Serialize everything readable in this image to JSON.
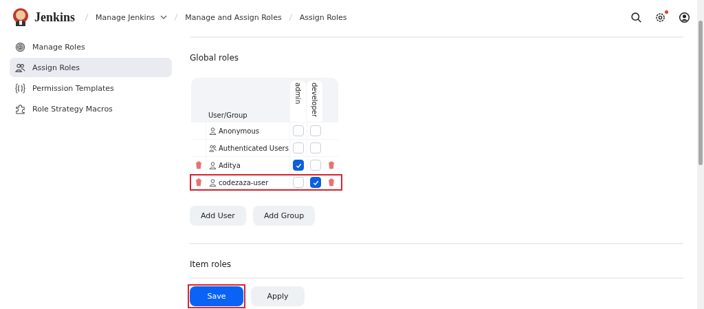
{
  "header": {
    "brand": "Jenkins",
    "breadcrumbs": [
      {
        "label": "Manage Jenkins",
        "has_menu": true
      },
      {
        "label": "Manage and Assign Roles",
        "has_menu": false
      },
      {
        "label": "Assign Roles",
        "has_menu": false
      }
    ],
    "settings_alert": true
  },
  "sidebar": {
    "items": [
      {
        "label": "Manage Roles",
        "selected": false
      },
      {
        "label": "Assign Roles",
        "selected": true
      },
      {
        "label": "Permission Templates",
        "selected": false
      },
      {
        "label": "Role Strategy Macros",
        "selected": false
      }
    ]
  },
  "global_roles": {
    "title": "Global roles",
    "user_column": "User/Group",
    "roles": [
      "admin",
      "developer"
    ],
    "rows": [
      {
        "name": "Anonymous",
        "kind": "user",
        "deletable": false,
        "checked": [
          false,
          false
        ],
        "highlighted": false
      },
      {
        "name": "Authenticated Users",
        "kind": "group",
        "deletable": false,
        "checked": [
          false,
          false
        ],
        "highlighted": false
      },
      {
        "name": "Aditya",
        "kind": "user",
        "deletable": true,
        "checked": [
          true,
          false
        ],
        "highlighted": false
      },
      {
        "name": "codezaza-user",
        "kind": "user",
        "deletable": true,
        "checked": [
          false,
          true
        ],
        "highlighted": true
      }
    ],
    "buttons": [
      "Add User",
      "Add Group"
    ]
  },
  "item_roles": {
    "title": "Item roles"
  },
  "actions": [
    {
      "label": "Save",
      "kind": "primary",
      "highlighted": true
    },
    {
      "label": "Apply",
      "kind": "secondary",
      "highlighted": false
    }
  ]
}
